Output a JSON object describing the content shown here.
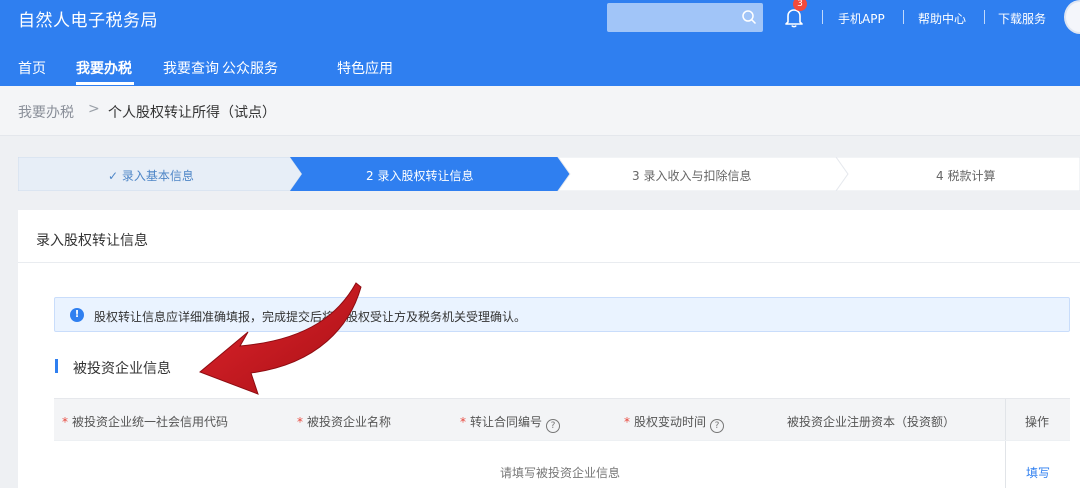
{
  "header": {
    "app_title": "自然人电子税务局",
    "search_placeholder": "",
    "notification_count": "3",
    "util_links": [
      "手机APP",
      "帮助中心",
      "下载服务"
    ]
  },
  "nav": {
    "items": [
      "首页",
      "我要办税",
      "我要查询",
      "公众服务",
      "特色应用"
    ],
    "active": "我要办税"
  },
  "breadcrumb": {
    "home": "我要办税",
    "separator": ">",
    "current": "个人股权转让所得（试点）"
  },
  "steps": [
    {
      "label": "✓ 录入基本信息",
      "status": "done"
    },
    {
      "label": "2  录入股权转让信息",
      "status": "active"
    },
    {
      "label": "3  录入收入与扣除信息",
      "status": "todo"
    },
    {
      "label": "4  税款计算",
      "status": "todo"
    }
  ],
  "panel": {
    "title": "录入股权转让信息",
    "notice": "股权转让信息应详细准确填报，完成提交后将由股权受让方及税务机关受理确认。",
    "section_title": "被投资企业信息"
  },
  "table": {
    "columns": [
      {
        "label": "被投资企业统一社会信用代码",
        "required": true,
        "help": false
      },
      {
        "label": "被投资企业名称",
        "required": true,
        "help": false
      },
      {
        "label": "转让合同编号",
        "required": true,
        "help": true
      },
      {
        "label": "股权变动时间",
        "required": true,
        "help": true
      },
      {
        "label": "被投资企业注册资本（投资额）",
        "required": false,
        "help": false
      },
      {
        "label": "操作",
        "required": false,
        "help": false
      }
    ],
    "required_mark": "*",
    "help_mark": "?",
    "empty_text": "请填写被投资企业信息",
    "action_label": "填写"
  },
  "colors": {
    "brand_blue": "#2f7ff0",
    "step_done_bg": "#e7eef7",
    "annotation_arrow": "#c8141b"
  },
  "icons": [
    "search-icon",
    "bell-icon",
    "avatar",
    "info-icon",
    "help-icon",
    "annotation-arrow"
  ]
}
